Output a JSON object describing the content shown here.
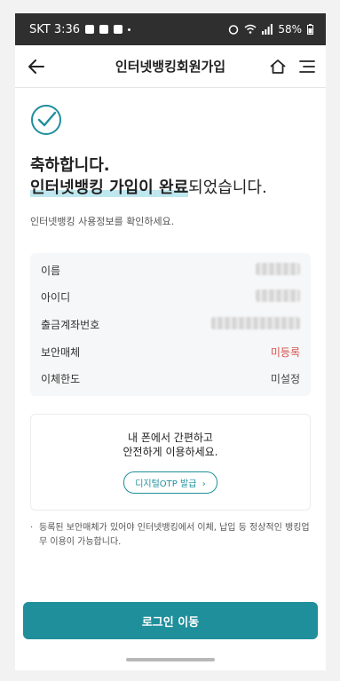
{
  "status_bar": {
    "carrier_time": "SKT 3:36",
    "battery": "58%"
  },
  "header": {
    "title": "인터넷뱅킹회원가입"
  },
  "message": {
    "line1": "축하합니다.",
    "line2_highlight": "인터넷뱅킹 가입이 완료",
    "line2_rest": "되었습니다."
  },
  "subtitle": "인터넷뱅킹 사용정보를 확인하세요.",
  "info_rows": [
    {
      "label": "이름",
      "value": ""
    },
    {
      "label": "아이디",
      "value": ""
    },
    {
      "label": "출금계좌번호",
      "value": ""
    },
    {
      "label": "보안매체",
      "value": "미등록"
    },
    {
      "label": "이체한도",
      "value": "미설정"
    }
  ],
  "promo": {
    "line1": "내 폰에서 간편하고",
    "line2": "안전하게 이용하세요.",
    "button": "디지털OTP 발급"
  },
  "note": "등록된 보안매체가 있어야 인터넷뱅킹에서 이체, 납입 등 정상적인 뱅킹업무 이용이 가능합니다.",
  "login_button": "로그인 이동",
  "colors": {
    "accent": "#1f8f9c",
    "warn": "#d9534f"
  }
}
